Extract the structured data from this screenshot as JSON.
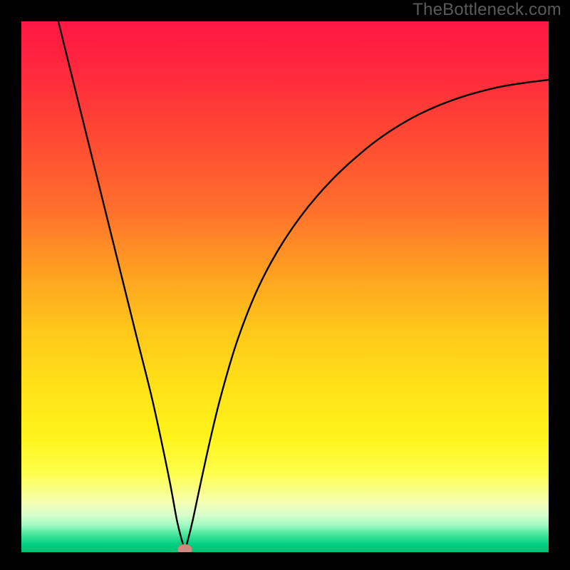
{
  "watermark": "TheBottleneck.com",
  "colors": {
    "bg": "#000000",
    "curve": "#000000",
    "marker_fill": "#cf8a7f",
    "marker_stroke": "#b06a5f",
    "gradient_stops": [
      {
        "offset": 0.0,
        "color": "#ff1744"
      },
      {
        "offset": 0.1,
        "color": "#ff2a3c"
      },
      {
        "offset": 0.22,
        "color": "#ff4a33"
      },
      {
        "offset": 0.35,
        "color": "#ff6e2c"
      },
      {
        "offset": 0.48,
        "color": "#ffa321"
      },
      {
        "offset": 0.58,
        "color": "#ffc71a"
      },
      {
        "offset": 0.68,
        "color": "#ffe018"
      },
      {
        "offset": 0.78,
        "color": "#fff31a"
      },
      {
        "offset": 0.85,
        "color": "#fdff4a"
      },
      {
        "offset": 0.905,
        "color": "#f6ffb0"
      },
      {
        "offset": 0.93,
        "color": "#d9ffcd"
      },
      {
        "offset": 0.95,
        "color": "#9cf8c0"
      },
      {
        "offset": 0.965,
        "color": "#4fe7a0"
      },
      {
        "offset": 0.985,
        "color": "#00d080"
      },
      {
        "offset": 1.0,
        "color": "#00c074"
      }
    ]
  },
  "chart_data": {
    "type": "line",
    "title": "",
    "xlabel": "",
    "ylabel": "",
    "xlim": [
      0,
      100
    ],
    "ylim": [
      0,
      100
    ],
    "grid": false,
    "legend": false,
    "series": [
      {
        "name": "bottleneck-curve",
        "x": [
          7,
          10,
          13,
          16,
          19,
          22,
          25,
          28,
          29.5,
          30.5,
          31,
          31.5,
          32.5,
          34,
          36,
          38,
          41,
          45,
          50,
          56,
          63,
          71,
          80,
          90,
          100
        ],
        "y": [
          100,
          88,
          76,
          64,
          52,
          40,
          28,
          14,
          6,
          2,
          0.5,
          2,
          6,
          13,
          22,
          30,
          40,
          50,
          59,
          67,
          74,
          80,
          84.5,
          87.5,
          89
        ]
      }
    ],
    "marker": {
      "x": 31,
      "y": 0.5,
      "rx": 1.4,
      "ry": 1.0
    }
  }
}
